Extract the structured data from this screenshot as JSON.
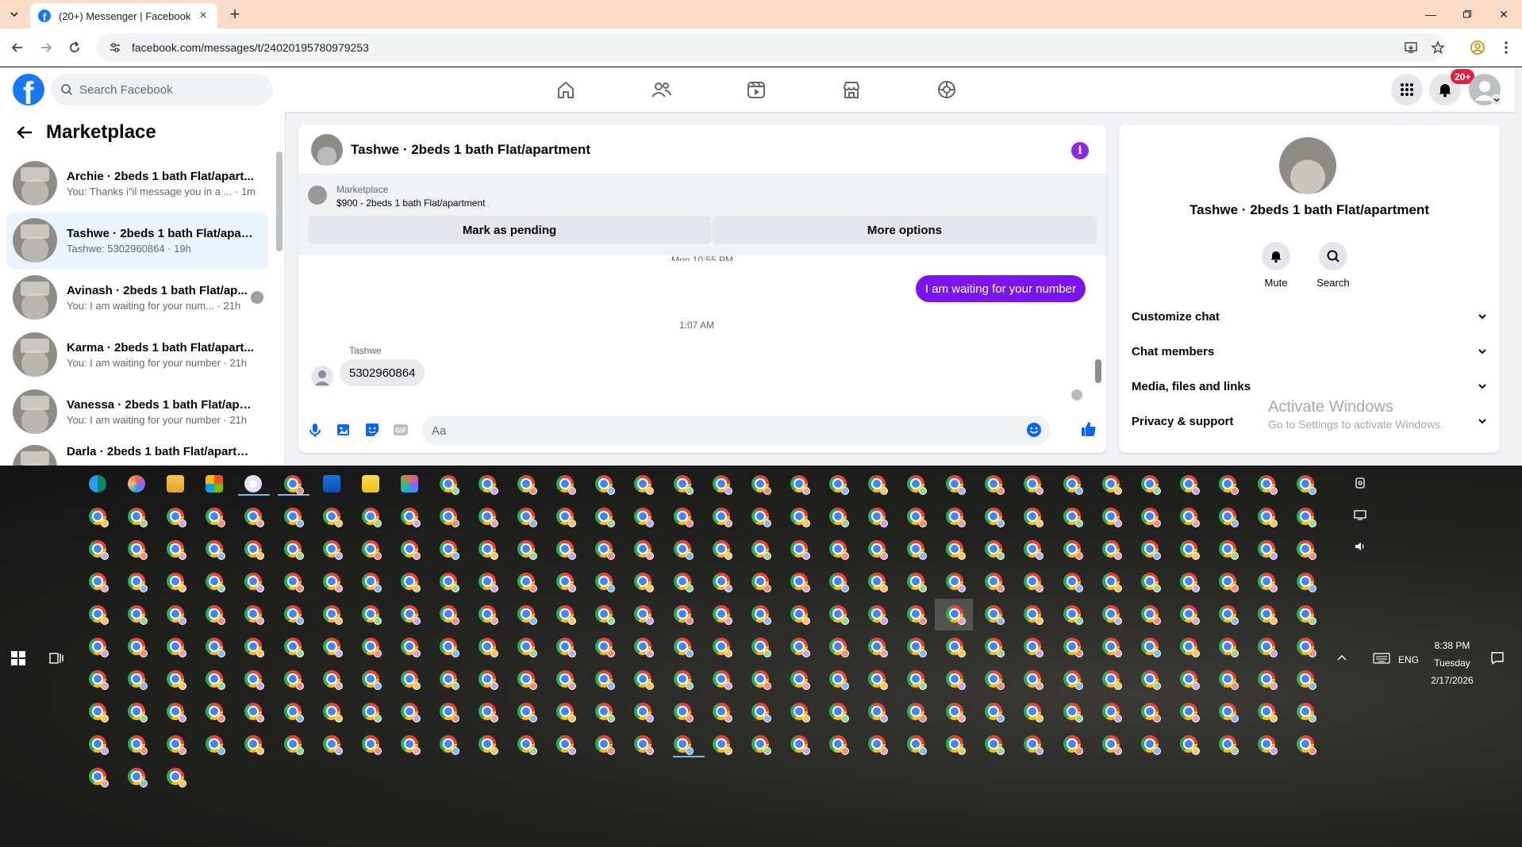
{
  "browser": {
    "tab_title": "(20+) Messenger | Facebook",
    "url": "facebook.com/messages/t/24020195780979253"
  },
  "fb": {
    "search_placeholder": "Search Facebook",
    "notification_badge": "20+",
    "brand_color": "#1877f2"
  },
  "sidebar": {
    "title": "Marketplace",
    "conversations": [
      {
        "name": "Archie · 2beds 1 bath Flat/apart...",
        "preview": "You: Thanks i\"il message you in a ... · 1m",
        "active": false
      },
      {
        "name": "Tashwe · 2beds 1 bath Flat/apart...",
        "preview": "Tashwe: 5302960864 · 19h",
        "active": true
      },
      {
        "name": "Avinash · 2beds 1 bath Flat/ap...",
        "preview": "You: I am waiting for your num... · 21h",
        "active": false
      },
      {
        "name": "Karma · 2beds 1 bath Flat/apart...",
        "preview": "You: I am waiting for your number · 21h",
        "active": false
      },
      {
        "name": "Vanessa · 2beds 1 bath Flat/apar...",
        "preview": "You: I am waiting for your number · 21h",
        "active": false
      },
      {
        "name": "Darla · 2beds 1 bath Flat/apartm...",
        "preview": "",
        "active": false
      }
    ]
  },
  "chat": {
    "title": "Tashwe · 2beds 1 bath Flat/apartment",
    "marketplace_label": "Marketplace",
    "listing": "$900 - 2beds 1 bath Flat/apartment",
    "mark_pending": "Mark as pending",
    "more_options": "More options",
    "time_top": "Mon 10:55 PM",
    "outgoing_message": "I am waiting for your number",
    "time_mid": "1:07 AM",
    "sender_name": "Tashwe",
    "incoming_message": "5302960864",
    "input_placeholder": "Aa",
    "accent": "#7b15f0"
  },
  "info": {
    "name": "Tashwe · 2beds 1 bath Flat/apartment",
    "mute": "Mute",
    "search": "Search",
    "rows": [
      "Customize chat",
      "Chat members",
      "Media, files and links",
      "Privacy & support"
    ]
  },
  "watermark": {
    "line1": "Activate Windows",
    "line2": "Go to Settings to activate Windows."
  },
  "taskbar": {
    "lang": "ENG",
    "time": "8:38 PM",
    "day": "Tuesday",
    "date": "2/17/2026"
  }
}
